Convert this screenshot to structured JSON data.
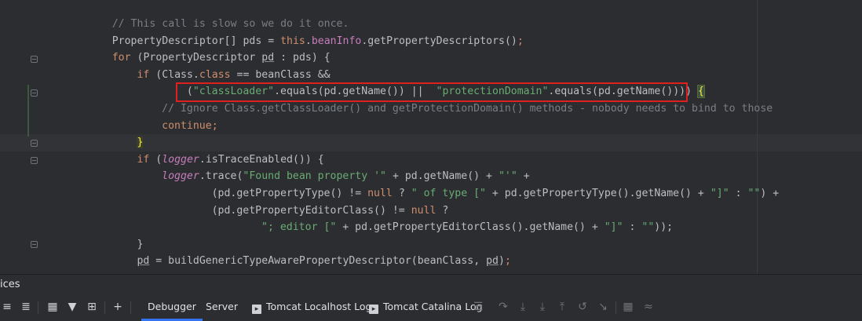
{
  "editor": {
    "lines": [
      {
        "indent": 18,
        "tokens": [
          {
            "t": "// This call is slow so we do it once.",
            "c": "c"
          }
        ]
      },
      {
        "indent": 18,
        "tokens": [
          {
            "t": "PropertyDescriptor[] pds = "
          },
          {
            "t": "this",
            "c": "kw"
          },
          {
            "t": "."
          },
          {
            "t": "beanInfo",
            "c": "fld"
          },
          {
            "t": ".getPropertyDescriptors()"
          },
          {
            "t": ";",
            "c": "kw"
          }
        ]
      },
      {
        "indent": 18,
        "tokens": [
          {
            "t": "for",
            "c": "kw"
          },
          {
            "t": " (PropertyDescriptor "
          },
          {
            "t": "pd",
            "c": "ul"
          },
          {
            "t": " : pds) {"
          }
        ]
      },
      {
        "indent": 22,
        "tokens": [
          {
            "t": "if",
            "c": "kw"
          },
          {
            "t": " (Class."
          },
          {
            "t": "class",
            "c": "kw"
          },
          {
            "t": " == beanClass &&"
          }
        ]
      },
      {
        "indent": 30,
        "tokens": [
          {
            "t": "("
          },
          {
            "t": "\"classLoader\"",
            "c": "str"
          },
          {
            "t": ".equals(pd.getName()) ||  "
          },
          {
            "t": "\"protectionDomain\"",
            "c": "str"
          },
          {
            "t": ".equals(pd.getName()))) "
          },
          {
            "t": "{",
            "c": "brace"
          }
        ]
      },
      {
        "indent": 26,
        "tokens": [
          {
            "t": "// Ignore Class.getClassLoader() and getProtectionDomain() methods - nobody needs to bind to those",
            "c": "c"
          }
        ]
      },
      {
        "indent": 26,
        "tokens": [
          {
            "t": "continue",
            "c": "kw"
          },
          {
            "t": ";",
            "c": "kw"
          }
        ]
      },
      {
        "indent": 22,
        "tokens": [
          {
            "t": "}",
            "c": "bracehl"
          }
        ]
      },
      {
        "indent": 22,
        "tokens": [
          {
            "t": "if",
            "c": "kw"
          },
          {
            "t": " ("
          },
          {
            "t": "logger",
            "c": "itl"
          },
          {
            "t": ".isTraceEnabled()) {"
          }
        ]
      },
      {
        "indent": 26,
        "tokens": [
          {
            "t": "logger",
            "c": "itl"
          },
          {
            "t": ".trace("
          },
          {
            "t": "\"Found bean property '\"",
            "c": "str"
          },
          {
            "t": " + pd.getName() + "
          },
          {
            "t": "\"'\"",
            "c": "str"
          },
          {
            "t": " +"
          }
        ]
      },
      {
        "indent": 34,
        "tokens": [
          {
            "t": "(pd.getPropertyType() != "
          },
          {
            "t": "null",
            "c": "kw"
          },
          {
            "t": " ? "
          },
          {
            "t": "\" of type [\"",
            "c": "str"
          },
          {
            "t": " + pd.getPropertyType().getName() + "
          },
          {
            "t": "\"]\"",
            "c": "str"
          },
          {
            "t": " : "
          },
          {
            "t": "\"\"",
            "c": "str"
          },
          {
            "t": ") +"
          }
        ]
      },
      {
        "indent": 34,
        "tokens": [
          {
            "t": "(pd.getPropertyEditorClass() != "
          },
          {
            "t": "null",
            "c": "kw"
          },
          {
            "t": " ?"
          }
        ]
      },
      {
        "indent": 42,
        "tokens": [
          {
            "t": "\"; editor [\"",
            "c": "str"
          },
          {
            "t": " + pd.getPropertyEditorClass().getName() + "
          },
          {
            "t": "\"]\"",
            "c": "str"
          },
          {
            "t": " : "
          },
          {
            "t": "\"\"",
            "c": "str"
          },
          {
            "t": "));"
          }
        ]
      },
      {
        "indent": 22,
        "tokens": [
          {
            "t": "}"
          }
        ]
      },
      {
        "indent": 22,
        "tokens": [
          {
            "t": "pd",
            "c": "ul"
          },
          {
            "t": " = buildGenericTypeAwarePropertyDescriptor(beanClass, "
          },
          {
            "t": "pd",
            "c": "ul"
          },
          {
            "t": ")"
          },
          {
            "t": ";",
            "c": "kw"
          }
        ]
      }
    ]
  },
  "services": {
    "title": "ices"
  },
  "toolbar": {
    "tabs": [
      {
        "label": "Debugger",
        "active": true,
        "icon": ""
      },
      {
        "label": "Server",
        "active": false,
        "icon": ""
      },
      {
        "label": "Tomcat Localhost Log",
        "active": false,
        "icon": "console-icon"
      },
      {
        "label": "Tomcat Catalina Log",
        "active": false,
        "icon": "console-icon"
      }
    ],
    "left_icons": [
      "expand-all-icon",
      "collapse-all-icon",
      "group-icon",
      "filter-icon",
      "add-service-icon",
      "add-icon"
    ],
    "right_icons": [
      "menu-icon",
      "step-over-icon",
      "step-into-icon",
      "force-step-into-icon",
      "step-out-icon",
      "drop-frame-icon",
      "run-to-cursor-icon",
      "evaluate-icon",
      "trace-icon"
    ]
  }
}
